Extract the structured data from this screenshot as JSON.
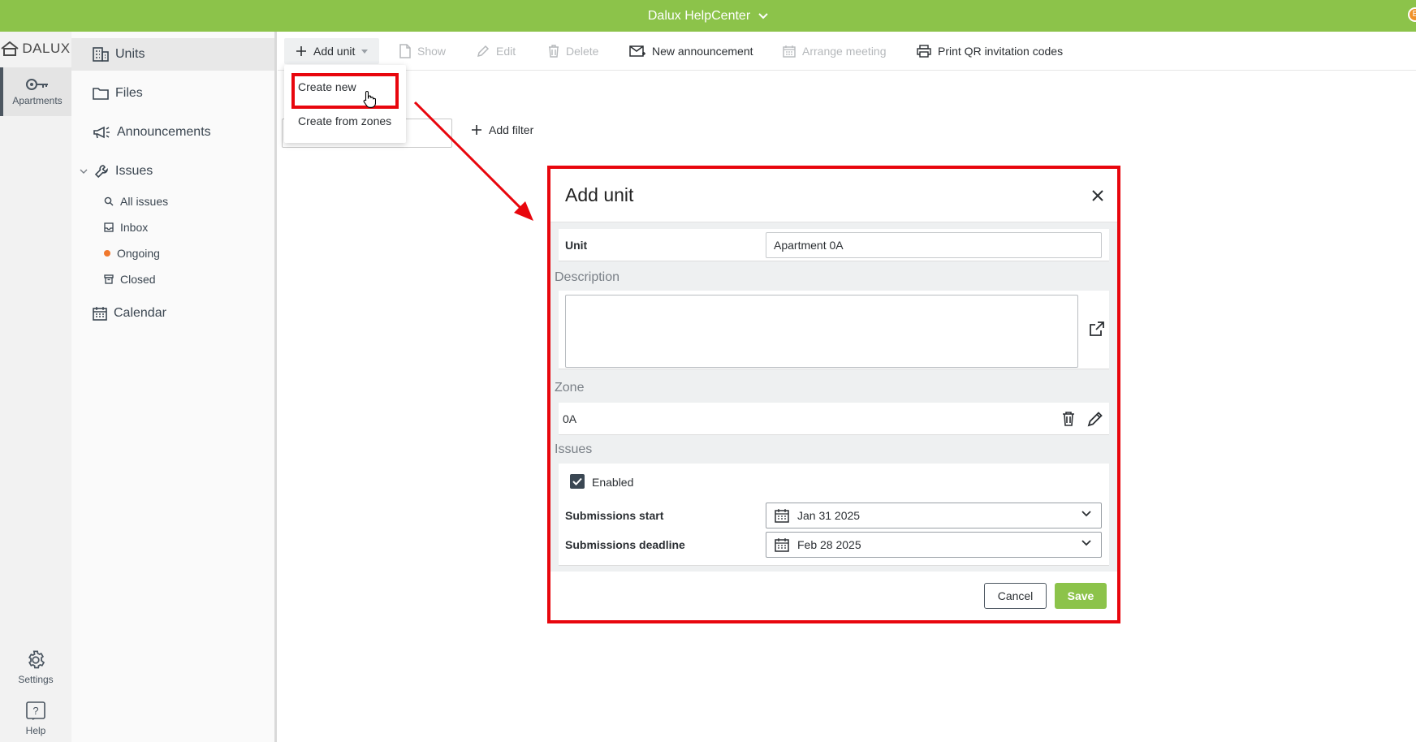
{
  "topbar": {
    "title": "Dalux HelpCenter",
    "avatar_letter": "E"
  },
  "rail": {
    "logo_text": "DALUX",
    "app_label": "Apartments",
    "settings_label": "Settings",
    "help_label": "Help"
  },
  "nav": {
    "units": "Units",
    "files": "Files",
    "announcements": "Announcements",
    "issues": "Issues",
    "all_issues": "All issues",
    "inbox": "Inbox",
    "ongoing": "Ongoing",
    "closed": "Closed",
    "calendar": "Calendar"
  },
  "toolbar": {
    "add_unit": "Add unit",
    "show": "Show",
    "edit": "Edit",
    "delete": "Delete",
    "new_announcement": "New announcement",
    "arrange_meeting": "Arrange meeting",
    "print_qr": "Print QR invitation codes"
  },
  "dropdown": {
    "create_new": "Create new",
    "create_from_zones": "Create from zones"
  },
  "filter": {
    "add_filter": "Add filter"
  },
  "dialog": {
    "title": "Add unit",
    "unit_label": "Unit",
    "unit_value": "Apartment 0A",
    "description_label": "Description",
    "description_value": "",
    "zone_label": "Zone",
    "zone_value": "0A",
    "issues_label": "Issues",
    "enabled_label": "Enabled",
    "enabled_checked": true,
    "submissions_start_label": "Submissions start",
    "submissions_start_value": "Jan 31 2025",
    "submissions_deadline_label": "Submissions deadline",
    "submissions_deadline_value": "Feb 28 2025",
    "cancel": "Cancel",
    "save": "Save"
  },
  "colors": {
    "brand_green": "#8cc34a",
    "highlight_red": "#e8060d",
    "accent_orange": "#f0782d"
  }
}
